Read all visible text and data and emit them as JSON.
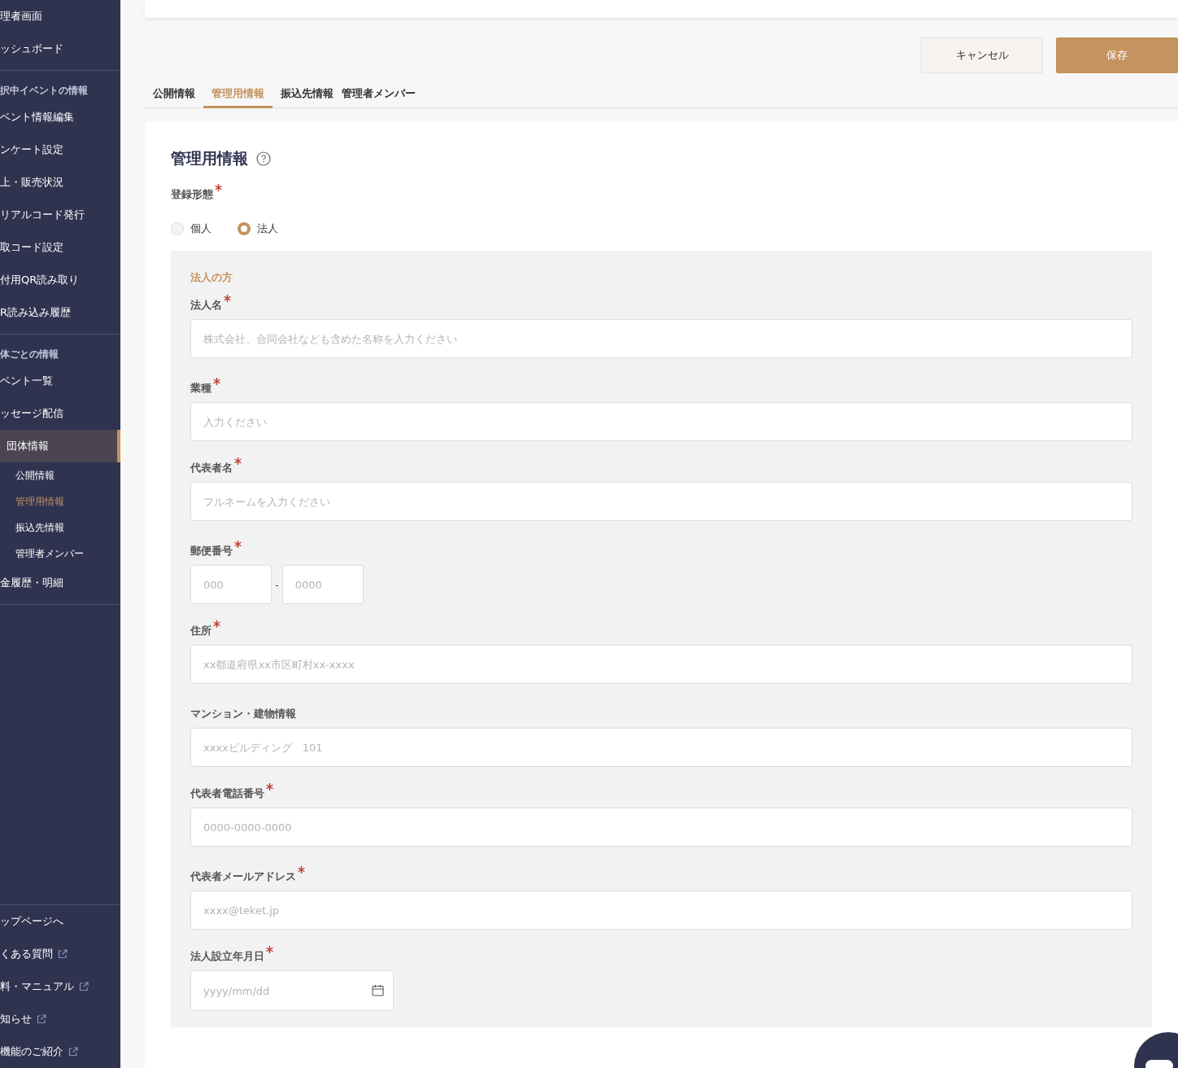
{
  "sidebar": {
    "sections": [
      {
        "items": [
          {
            "label": "理者画面",
            "selected": false,
            "external": false
          },
          {
            "label": "ッシュボード",
            "selected": false,
            "external": false
          }
        ]
      },
      {
        "heading": "択中イベントの情報",
        "items": [
          {
            "label": "ベント情報編集",
            "selected": false,
            "external": false
          },
          {
            "label": "ンケート設定",
            "selected": false,
            "external": false
          },
          {
            "label": "上・販売状況",
            "selected": false,
            "external": false
          },
          {
            "label": "リアルコード発行",
            "selected": false,
            "external": false
          },
          {
            "label": "取コード設定",
            "selected": false,
            "external": false
          },
          {
            "label": "付用QR読み取り",
            "selected": false,
            "external": false
          },
          {
            "label": "R読み込み履歴",
            "selected": false,
            "external": false
          }
        ]
      },
      {
        "heading": "体ごとの情報",
        "items": [
          {
            "label": "ベント一覧",
            "selected": false,
            "external": false
          },
          {
            "label": "ッセージ配信",
            "selected": false,
            "external": false
          },
          {
            "label": "団体情報",
            "selected": true,
            "external": false,
            "children": [
              {
                "label": "公開情報",
                "selected": false
              },
              {
                "label": "管理用情報",
                "selected": true
              },
              {
                "label": "振込先情報",
                "selected": false
              },
              {
                "label": "管理者メンバー",
                "selected": false
              }
            ]
          },
          {
            "label": "金履歴・明細",
            "selected": false,
            "external": false
          }
        ]
      }
    ],
    "footer": [
      {
        "label": "ップページへ",
        "external": false
      },
      {
        "label": "くある質問",
        "external": true
      },
      {
        "label": "料・マニュアル",
        "external": true
      },
      {
        "label": "知らせ",
        "external": true
      },
      {
        "label": "機能のご紹介",
        "external": true
      }
    ]
  },
  "actions": {
    "cancel": "キャンセル",
    "save": "保存"
  },
  "tabs": [
    {
      "label": "公開情報",
      "selected": false
    },
    {
      "label": "管理用情報",
      "selected": true
    },
    {
      "label": "振込先情報",
      "selected": false
    },
    {
      "label": "管理者メンバー",
      "selected": false
    }
  ],
  "form": {
    "title": "管理用情報",
    "registration": {
      "label": "登録形態",
      "required": true,
      "options": [
        {
          "label": "個人",
          "selected": false
        },
        {
          "label": "法人",
          "selected": true
        }
      ]
    },
    "section_title": "法人の方",
    "fields": [
      {
        "kind": "text",
        "label": "法人名",
        "required": true,
        "placeholder": "株式会社、合同会社なども含めた名称を入力ください"
      },
      {
        "kind": "text",
        "label": "業種",
        "required": true,
        "placeholder": "入力ください"
      },
      {
        "kind": "text",
        "label": "代表者名",
        "required": true,
        "placeholder": "フルネームを入力ください"
      },
      {
        "kind": "postal",
        "label": "郵便番号",
        "required": true,
        "placeholder": "000",
        "placeholder_2": "0000",
        "separator": "-"
      },
      {
        "kind": "text",
        "label": "住所",
        "required": true,
        "placeholder": "xx都道府県xx市区町村xx-xxxx"
      },
      {
        "kind": "text",
        "label": "マンション・建物情報",
        "required": false,
        "placeholder": "xxxxビルディング　101"
      },
      {
        "kind": "text",
        "label": "代表者電話番号",
        "required": true,
        "placeholder": "0000-0000-0000"
      },
      {
        "kind": "text",
        "label": "代表者メールアドレス",
        "required": true,
        "placeholder": "xxxx@teket.jp"
      },
      {
        "kind": "date",
        "label": "法人設立年月日",
        "required": true,
        "placeholder": "yyyy/mm/dd"
      }
    ]
  }
}
